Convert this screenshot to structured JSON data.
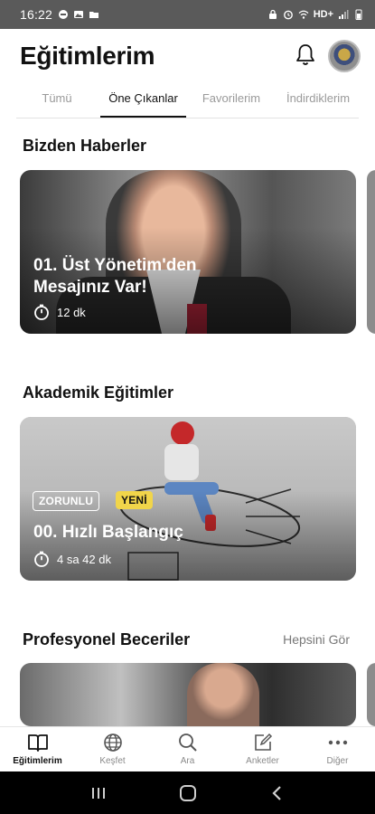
{
  "status_bar": {
    "time": "16:22",
    "network_label": "HD+"
  },
  "header": {
    "title": "Eğitimlerim"
  },
  "tabs": [
    {
      "label": "Tümü",
      "active": false
    },
    {
      "label": "Öne Çıkanlar",
      "active": true
    },
    {
      "label": "Favorilerim",
      "active": false
    },
    {
      "label": "İndirdiklerim",
      "active": false
    }
  ],
  "sections": [
    {
      "title": "Bizden Haberler",
      "card": {
        "title_line1": "01. Üst Yönetim'den",
        "title_line2": "Mesajınız Var!",
        "duration": "12 dk"
      }
    },
    {
      "title": "Akademik Eğitimler",
      "card": {
        "badge_required": "ZORUNLU",
        "badge_new": "YENİ",
        "title_line1": "00. Hızlı Başlangıç",
        "duration": "4 sa 42 dk"
      }
    },
    {
      "title": "Profesyonel Beceriler",
      "see_all": "Hepsini Gör"
    }
  ],
  "bottom_nav": [
    {
      "label": "Eğitimlerim",
      "icon": "book-icon",
      "active": true
    },
    {
      "label": "Keşfet",
      "icon": "globe-icon",
      "active": false
    },
    {
      "label": "Ara",
      "icon": "search-icon",
      "active": false
    },
    {
      "label": "Anketler",
      "icon": "edit-icon",
      "active": false
    },
    {
      "label": "Diğer",
      "icon": "more-icon",
      "active": false
    }
  ],
  "colors": {
    "badge_yellow": "#f1d54a",
    "active_text": "#111111",
    "inactive_text": "#9a9a9a"
  }
}
